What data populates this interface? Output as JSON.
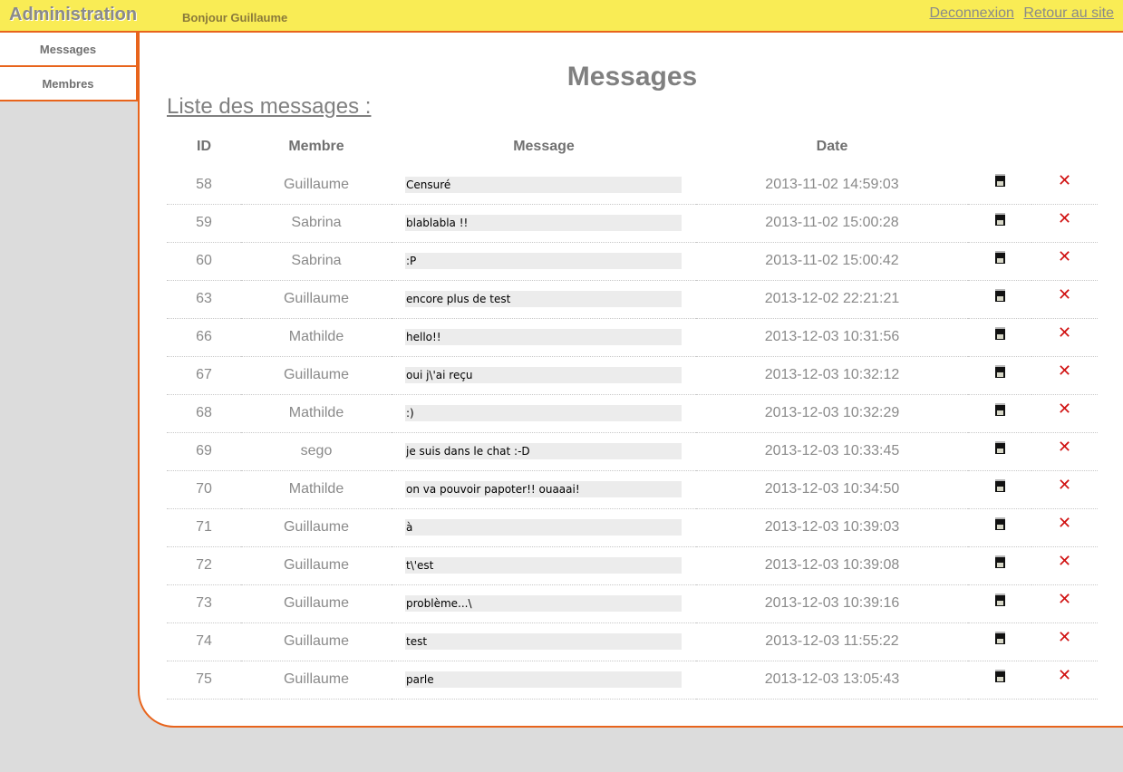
{
  "header": {
    "title": "Administration",
    "greeting": "Bonjour Guillaume",
    "logout_label": "Deconnexion",
    "back_label": "Retour au site"
  },
  "sidebar": {
    "items": [
      {
        "label": "Messages"
      },
      {
        "label": "Membres"
      }
    ]
  },
  "main": {
    "page_title": "Messages",
    "list_heading": "Liste des messages :",
    "columns": [
      "ID",
      "Membre",
      "Message",
      "Date"
    ],
    "rows": [
      {
        "id": "58",
        "member": "Guillaume",
        "message": "Censuré",
        "date": "2013-11-02 14:59:03"
      },
      {
        "id": "59",
        "member": "Sabrina",
        "message": "blablabla !!",
        "date": "2013-11-02 15:00:28"
      },
      {
        "id": "60",
        "member": "Sabrina",
        "message": ":P",
        "date": "2013-11-02 15:00:42"
      },
      {
        "id": "63",
        "member": "Guillaume",
        "message": "encore plus de test",
        "date": "2013-12-02 22:21:21"
      },
      {
        "id": "66",
        "member": "Mathilde",
        "message": "hello!!",
        "date": "2013-12-03 10:31:56"
      },
      {
        "id": "67",
        "member": "Guillaume",
        "message": "oui j\\'ai reçu",
        "date": "2013-12-03 10:32:12"
      },
      {
        "id": "68",
        "member": "Mathilde",
        "message": ":)",
        "date": "2013-12-03 10:32:29"
      },
      {
        "id": "69",
        "member": "sego",
        "message": "je suis dans le chat :-D",
        "date": "2013-12-03 10:33:45"
      },
      {
        "id": "70",
        "member": "Mathilde",
        "message": "on va pouvoir papoter!! ouaaai!",
        "date": "2013-12-03 10:34:50"
      },
      {
        "id": "71",
        "member": "Guillaume",
        "message": "à",
        "date": "2013-12-03 10:39:03"
      },
      {
        "id": "72",
        "member": "Guillaume",
        "message": "t\\'est",
        "date": "2013-12-03 10:39:08"
      },
      {
        "id": "73",
        "member": "Guillaume",
        "message": "problème...\\",
        "date": "2013-12-03 10:39:16"
      },
      {
        "id": "74",
        "member": "Guillaume",
        "message": "test",
        "date": "2013-12-03 11:55:22"
      },
      {
        "id": "75",
        "member": "Guillaume",
        "message": "parle",
        "date": "2013-12-03 13:05:43"
      }
    ],
    "edit_icon": "save-icon",
    "delete_icon": "delete-x-icon",
    "delete_glyph": "✕"
  },
  "colors": {
    "topbar": "#f9ec55",
    "accent": "#e8641c",
    "background": "#dcdcdc",
    "delete": "#d01010"
  }
}
